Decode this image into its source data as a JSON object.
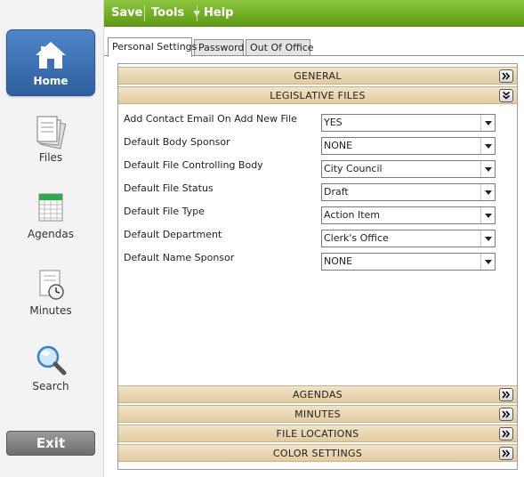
{
  "sidebar": {
    "items": [
      {
        "label": "Home",
        "icon": "home-icon",
        "active": true
      },
      {
        "label": "Files",
        "icon": "files-icon",
        "active": false
      },
      {
        "label": "Agendas",
        "icon": "calendar-icon",
        "active": false
      },
      {
        "label": "Minutes",
        "icon": "clock-document-icon",
        "active": false
      },
      {
        "label": "Search",
        "icon": "magnifier-icon",
        "active": false
      }
    ],
    "exit_label": "Exit"
  },
  "toolbar": {
    "save_label": "Save",
    "tools_label": "Tools",
    "help_label": "Help"
  },
  "tabs": [
    {
      "label": "Personal Settings",
      "active": true
    },
    {
      "label": "Password",
      "active": false
    },
    {
      "label": "Out Of Office",
      "active": false
    }
  ],
  "sections": {
    "general": "GENERAL",
    "legislative_files": "LEGISLATIVE FILES",
    "agendas": "AGENDAS",
    "minutes": "MINUTES",
    "file_locations": "FILE LOCATIONS",
    "color_settings": "COLOR SETTINGS"
  },
  "form": [
    {
      "label": "Add Contact Email On Add New File",
      "value": "YES"
    },
    {
      "label": "Default Body Sponsor",
      "value": "NONE"
    },
    {
      "label": "Default File Controlling Body",
      "value": "City Council"
    },
    {
      "label": "Default File Status",
      "value": "Draft"
    },
    {
      "label": "Default File Type",
      "value": "Action Item"
    },
    {
      "label": "Default Department",
      "value": "Clerk's Office"
    },
    {
      "label": "Default Name Sponsor",
      "value": "NONE"
    }
  ],
  "colors": {
    "toolbar_green": "#6fae1f",
    "nav_active_blue": "#3d72b5",
    "section_tan": "#e9d6b0"
  }
}
